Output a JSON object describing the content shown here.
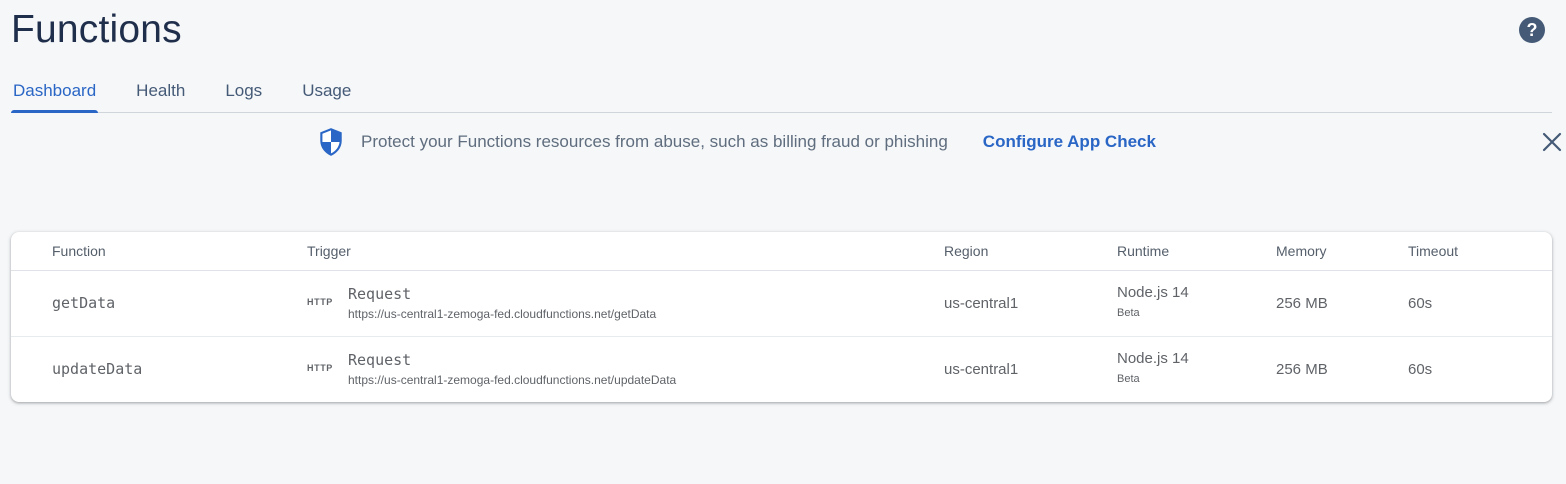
{
  "header": {
    "title": "Functions",
    "help_icon": "help-circle-icon"
  },
  "tabs": [
    {
      "label": "Dashboard",
      "active": true
    },
    {
      "label": "Health",
      "active": false
    },
    {
      "label": "Logs",
      "active": false
    },
    {
      "label": "Usage",
      "active": false
    }
  ],
  "banner": {
    "icon": "shield-icon",
    "text": "Protect your Functions resources from abuse, such as billing fraud or phishing",
    "link_label": "Configure App Check",
    "close_icon": "close-icon"
  },
  "table": {
    "columns": {
      "function": "Function",
      "trigger": "Trigger",
      "region": "Region",
      "runtime": "Runtime",
      "memory": "Memory",
      "timeout": "Timeout"
    },
    "rows": [
      {
        "function": "getData",
        "trigger_badge": "HTTP",
        "trigger_type": "Request",
        "trigger_url": "https://us-central1-zemoga-fed.cloudfunctions.net/getData",
        "region": "us-central1",
        "runtime": "Node.js 14",
        "runtime_note": "Beta",
        "memory": "256 MB",
        "timeout": "60s"
      },
      {
        "function": "updateData",
        "trigger_badge": "HTTP",
        "trigger_type": "Request",
        "trigger_url": "https://us-central1-zemoga-fed.cloudfunctions.net/updateData",
        "region": "us-central1",
        "runtime": "Node.js 14",
        "runtime_note": "Beta",
        "memory": "256 MB",
        "timeout": "60s"
      }
    ]
  },
  "colors": {
    "accent": "#2a66c5",
    "title": "#1f2e4a",
    "background": "#f5f7f9"
  }
}
